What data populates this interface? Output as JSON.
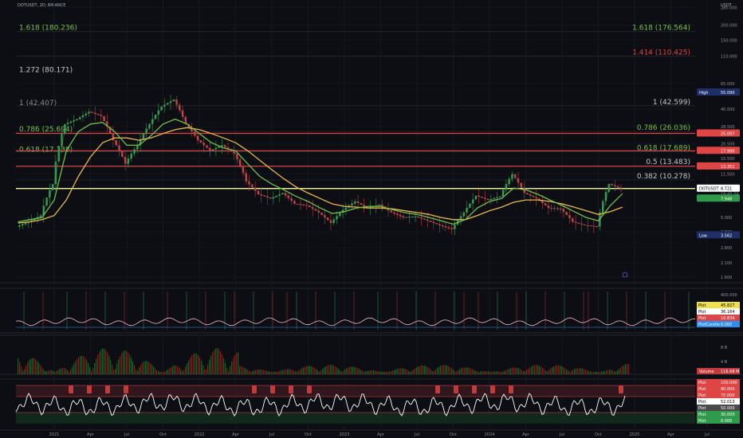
{
  "header": {
    "ticker": "DOTUSDT, 2D, BINANCE",
    "currency": "USDT"
  },
  "price_axis": [
    "280.000",
    "200.000",
    "150.000",
    "110.000",
    "65.000",
    "40.000",
    "28.500",
    "20.500",
    "15.500",
    "11.500",
    "8.500",
    "5.000",
    "3.800",
    "2.800",
    "2.100",
    "1.600"
  ],
  "time_axis": [
    "2021",
    "Apr",
    "Jul",
    "Oct",
    "2022",
    "Apr",
    "Jul",
    "Oct",
    "2023",
    "Apr",
    "Jul",
    "Oct",
    "2024",
    "Apr",
    "Jul",
    "Oct",
    "2025",
    "Apr",
    "Jul"
  ],
  "fib_left": [
    {
      "label": "1.618 (180.236)",
      "color": "#7bc043"
    },
    {
      "label": "1.272 (80.171)",
      "color": "#c6c6c6"
    },
    {
      "label": "1 (42.407)",
      "color": "#8a8a8a"
    },
    {
      "label": "0.786 (25.694)",
      "color": "#7bc043"
    },
    {
      "label": "0.618 (17.338)",
      "color": "#7bc043"
    }
  ],
  "fib_right": [
    {
      "label": "1.618 (176.564)",
      "color": "#7bc043"
    },
    {
      "label": "1.414 (110.425)",
      "color": "#e04545"
    },
    {
      "label": "1 (42.599)",
      "color": "#c6c6c6"
    },
    {
      "label": "0.786 (26.036)",
      "color": "#7bc043"
    },
    {
      "label": "0.618 (17.689)",
      "color": "#7bc043"
    },
    {
      "label": "0.5 (13.483)",
      "color": "#c6c6c6"
    },
    {
      "label": "0.382 (10.278)",
      "color": "#c6c6c6"
    }
  ],
  "price_tags": {
    "high_label": "High",
    "high_value": "55.090",
    "low_label": "Low",
    "low_value": "3.562",
    "symbol": "DOTUSDT",
    "last": "8.721",
    "countdown": "19:40:34",
    "ma_value": "7.948",
    "red1": "25.097",
    "red2": "17.990",
    "red3": "13.351"
  },
  "panel2_tags": [
    {
      "label": "Plot",
      "value": "45.827",
      "bg": "#f0e14a",
      "fg": "#000"
    },
    {
      "label": "Plot",
      "value": "36.164",
      "bg": "#ffffff",
      "fg": "#000"
    },
    {
      "label": "Plot",
      "value": "16.836",
      "bg": "#e04545",
      "fg": "#fff"
    },
    {
      "label": "PlotCandle",
      "value": "0.000",
      "bg": "#2a8ff0",
      "fg": "#fff"
    }
  ],
  "panel2_axis": "400.000",
  "panel3_tags": {
    "label": "Volume",
    "value": "116.68 M",
    "axis_top": "8 B",
    "axis_mid": "4 B"
  },
  "panel4_tags": [
    {
      "label": "Plot",
      "value": "100.000",
      "bg": "#e04545",
      "fg": "#fff"
    },
    {
      "label": "Plot",
      "value": "90.000",
      "bg": "#e04545",
      "fg": "#fff"
    },
    {
      "label": "Plot",
      "value": "70.000",
      "bg": "#e04545",
      "fg": "#fff"
    },
    {
      "label": "Plot",
      "value": "52.013",
      "bg": "#ffffff",
      "fg": "#000"
    },
    {
      "label": "Plot",
      "value": "50.000",
      "bg": "#4a4a4a",
      "fg": "#fff"
    },
    {
      "label": "Plot",
      "value": "30.000",
      "bg": "#2e9a4a",
      "fg": "#fff"
    },
    {
      "label": "Plot",
      "value": "0.000",
      "bg": "#2e9a4a",
      "fg": "#fff"
    }
  ],
  "colors": {
    "support_line": "#f2f7a0",
    "resistance": "#e04545",
    "ma_slow": "#e8b84a",
    "ma_fast": "#6fbf4a",
    "bull": "#2e9a4a",
    "bear": "#c23b3b"
  },
  "chart_data": {
    "type": "line",
    "title": "DOTUSDT, 2D, BINANCE",
    "y_scale": "log",
    "ylim": [
      1.5,
      300
    ],
    "x": [
      "2020-10",
      "2020-11",
      "2020-12",
      "2021-01",
      "2021-02",
      "2021-03",
      "2021-04",
      "2021-05",
      "2021-06",
      "2021-07",
      "2021-08",
      "2021-09",
      "2021-10",
      "2021-11",
      "2021-12",
      "2022-01",
      "2022-02",
      "2022-03",
      "2022-04",
      "2022-05",
      "2022-06",
      "2022-07",
      "2022-08",
      "2022-09",
      "2022-10",
      "2022-11",
      "2022-12",
      "2023-01",
      "2023-02",
      "2023-03",
      "2023-04",
      "2023-05",
      "2023-06",
      "2023-07",
      "2023-08",
      "2023-09",
      "2023-10",
      "2023-11",
      "2023-12",
      "2024-01",
      "2024-02",
      "2024-03",
      "2024-04",
      "2024-05",
      "2024-06",
      "2024-07",
      "2024-08",
      "2024-09",
      "2024-10",
      "2024-11",
      "2024-12"
    ],
    "series": [
      {
        "name": "DOTUSDT",
        "values": [
          4.2,
          4.6,
          5.2,
          9.5,
          30,
          33,
          38,
          35,
          22,
          14,
          20,
          30,
          42,
          48,
          30,
          22,
          18,
          20,
          17,
          10,
          7.8,
          7.2,
          8.0,
          6.5,
          6.3,
          5.5,
          4.5,
          5.8,
          6.8,
          6.0,
          6.4,
          5.5,
          5.0,
          5.1,
          4.7,
          4.3,
          4.0,
          5.5,
          7.6,
          7.0,
          7.5,
          11.5,
          8.0,
          7.2,
          6.0,
          5.9,
          4.6,
          4.3,
          4.2,
          9.5,
          8.7
        ]
      },
      {
        "values": [
          4.6,
          4.8,
          5.0,
          7.0,
          18,
          26,
          30,
          31,
          26,
          20,
          20,
          24,
          30,
          33,
          30,
          25,
          21,
          19,
          18,
          14,
          11,
          9.5,
          8.5,
          7.5,
          6.8,
          6.0,
          5.4,
          5.6,
          6.0,
          6.2,
          6.2,
          5.8,
          5.5,
          5.3,
          5.0,
          4.7,
          4.4,
          4.8,
          6.0,
          6.8,
          7.2,
          8.8,
          8.5,
          7.8,
          7.0,
          6.3,
          5.6,
          5.0,
          4.7,
          6.3,
          7.9
        ]
      },
      {
        "values": [
          4.5,
          4.6,
          4.8,
          5.2,
          7,
          11,
          16,
          21,
          23,
          23,
          22,
          23,
          25,
          27,
          28,
          27,
          25,
          23,
          21,
          18,
          15,
          12.5,
          10.5,
          9.0,
          8.0,
          7.2,
          6.5,
          6.2,
          6.1,
          6.0,
          6.0,
          5.9,
          5.7,
          5.5,
          5.3,
          5.0,
          4.8,
          4.8,
          5.2,
          5.7,
          6.1,
          6.7,
          7.0,
          7.0,
          6.8,
          6.5,
          6.1,
          5.7,
          5.3,
          5.6,
          6.1
        ]
      }
    ]
  }
}
